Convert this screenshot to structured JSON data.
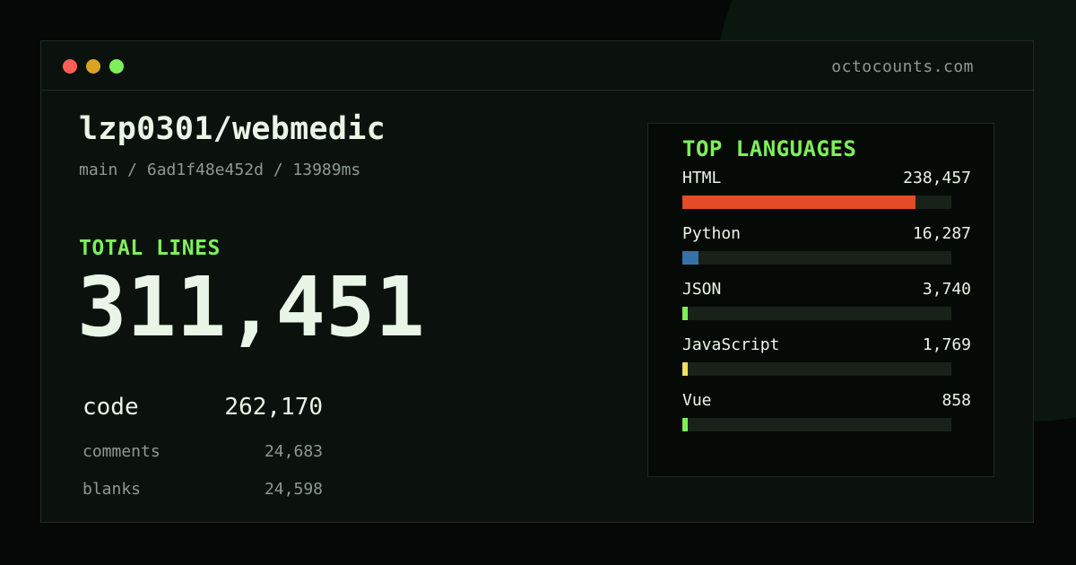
{
  "window": {
    "site": "octocounts.com"
  },
  "repo": {
    "name": "lzp0301/webmedic",
    "meta": "main / 6ad1f48e452d / 13989ms"
  },
  "totals": {
    "label": "TOTAL LINES",
    "value": "311,451",
    "stats": [
      {
        "key": "code",
        "value": "262,170"
      },
      {
        "key": "comments",
        "value": "24,683"
      },
      {
        "key": "blanks",
        "value": "24,598"
      }
    ]
  },
  "languages": {
    "title": "TOP LANGUAGES",
    "items": [
      {
        "name": "HTML",
        "count": "238,457",
        "share": 0.866,
        "color": "#e34c26"
      },
      {
        "name": "Python",
        "count": "16,287",
        "share": 0.06,
        "color": "#3572a5"
      },
      {
        "name": "JSON",
        "count": "3,740",
        "share": 0.02,
        "color": "#7ef05a"
      },
      {
        "name": "JavaScript",
        "count": "1,769",
        "share": 0.02,
        "color": "#f1e05a"
      },
      {
        "name": "Vue",
        "count": "858",
        "share": 0.02,
        "color": "#7ef05a"
      }
    ]
  },
  "colors": {
    "accent": "#7ef05a",
    "text": "#e9f5e6",
    "muted": "#8c9a8f"
  }
}
